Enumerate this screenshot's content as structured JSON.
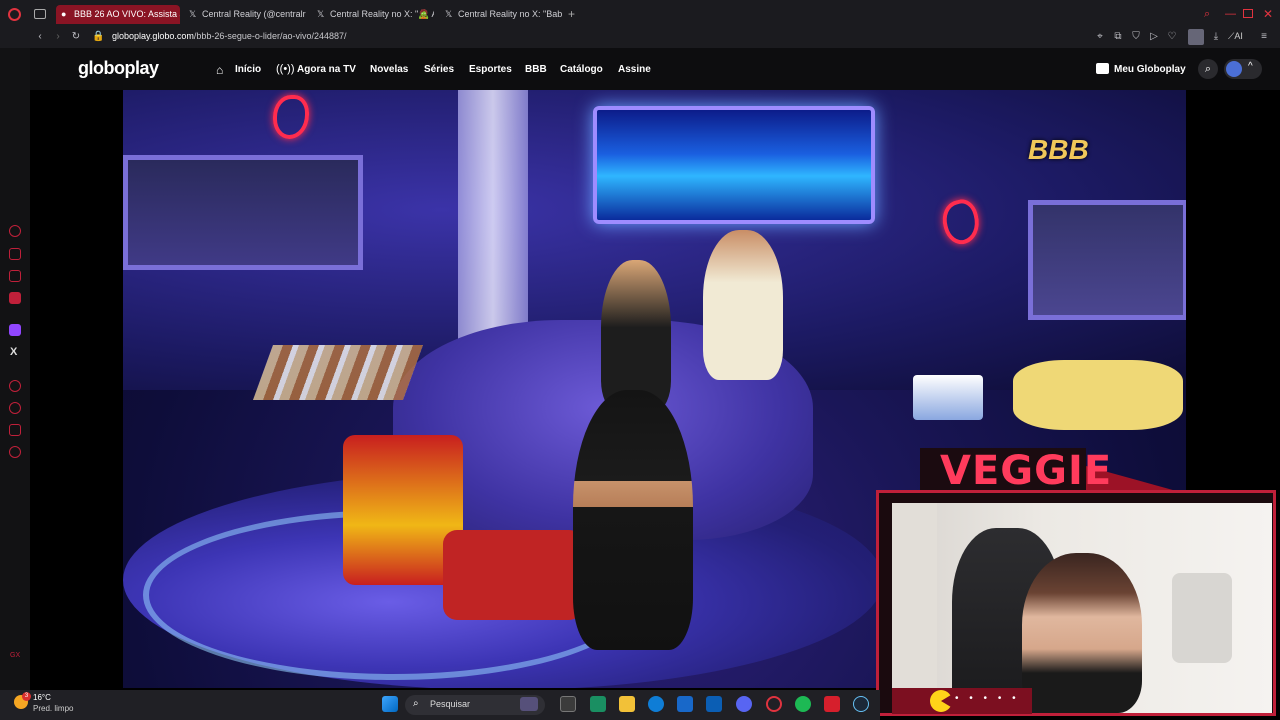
{
  "browser": {
    "tabs": [
      {
        "label": "BBB 26 AO VIVO: Assista a",
        "active": true
      },
      {
        "label": "Central Reality (@centralr",
        "active": false
      },
      {
        "label": "Central Reality no X: \"🧟 A",
        "active": false
      },
      {
        "label": "Central Reality no X: \"Bab",
        "active": false
      }
    ],
    "url_host": "globoplay.globo.com",
    "url_path": "/bbb-26-segue-o-lider/ao-vivo/244887/",
    "ai_label": "AI"
  },
  "globoplay": {
    "logo": "globoplay",
    "nav": [
      "Início",
      "Agora na TV",
      "Novelas",
      "Séries",
      "Esportes",
      "BBB",
      "Catálogo",
      "Assine"
    ],
    "account_label": "Meu Globoplay"
  },
  "video": {
    "channel_logo": "BBB"
  },
  "overlay": {
    "streamer_name": "VEGGIE",
    "bar_dots": "• • • • •"
  },
  "taskbar": {
    "weather_temp": "16°C",
    "weather_desc": "Pred. limpo",
    "notif_count": "3",
    "search_placeholder": "Pesquisar"
  },
  "colors": {
    "accent": "#c0203a",
    "tab_active": "#8a1424"
  }
}
